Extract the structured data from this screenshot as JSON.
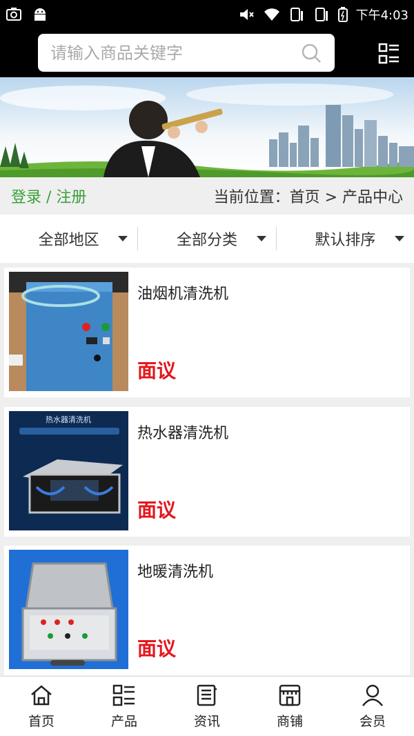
{
  "status": {
    "time": "下午4:03"
  },
  "search": {
    "placeholder": "请输入商品关键字"
  },
  "breadcrumb": {
    "login": "登录 / 注册",
    "location": "当前位置：首页 > 产品中心"
  },
  "filters": [
    {
      "label": "全部地区"
    },
    {
      "label": "全部分类"
    },
    {
      "label": "默认排序"
    }
  ],
  "products": [
    {
      "name": "油烟机清洗机",
      "price": "面议"
    },
    {
      "name": "热水器清洗机",
      "price": "面议"
    },
    {
      "name": "地暖清洗机",
      "price": "面议"
    }
  ],
  "banner": {
    "thumb_title_2": "热水器清洗机"
  },
  "nav": [
    {
      "label": "首页",
      "icon": "home-icon"
    },
    {
      "label": "产品",
      "icon": "product-grid-icon"
    },
    {
      "label": "资讯",
      "icon": "news-icon"
    },
    {
      "label": "商铺",
      "icon": "shop-icon"
    },
    {
      "label": "会员",
      "icon": "member-icon"
    }
  ],
  "colors": {
    "accent_green": "#3aa03a",
    "price_red": "#e4161d",
    "header_bg": "#000000"
  }
}
